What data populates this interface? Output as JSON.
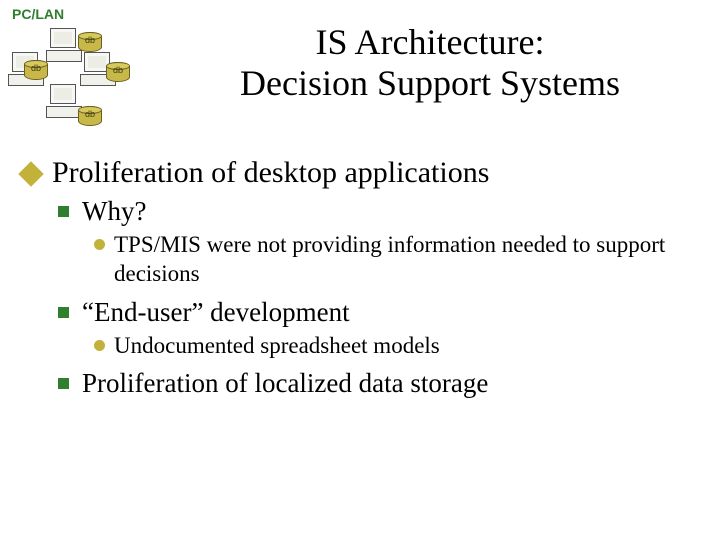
{
  "header": {
    "pc_lan_label": "PC/LAN",
    "db_label": "db"
  },
  "title": {
    "line1": "IS Architecture:",
    "line2": "Decision Support Systems"
  },
  "bullets": {
    "l1_1": "Proliferation of desktop applications",
    "l2_1": "Why?",
    "l3_1": "TPS/MIS were not providing information needed to support decisions",
    "l2_2": "“End-user” development",
    "l3_2": "Undocumented spreadsheet models",
    "l2_3": "Proliferation of localized data storage"
  }
}
